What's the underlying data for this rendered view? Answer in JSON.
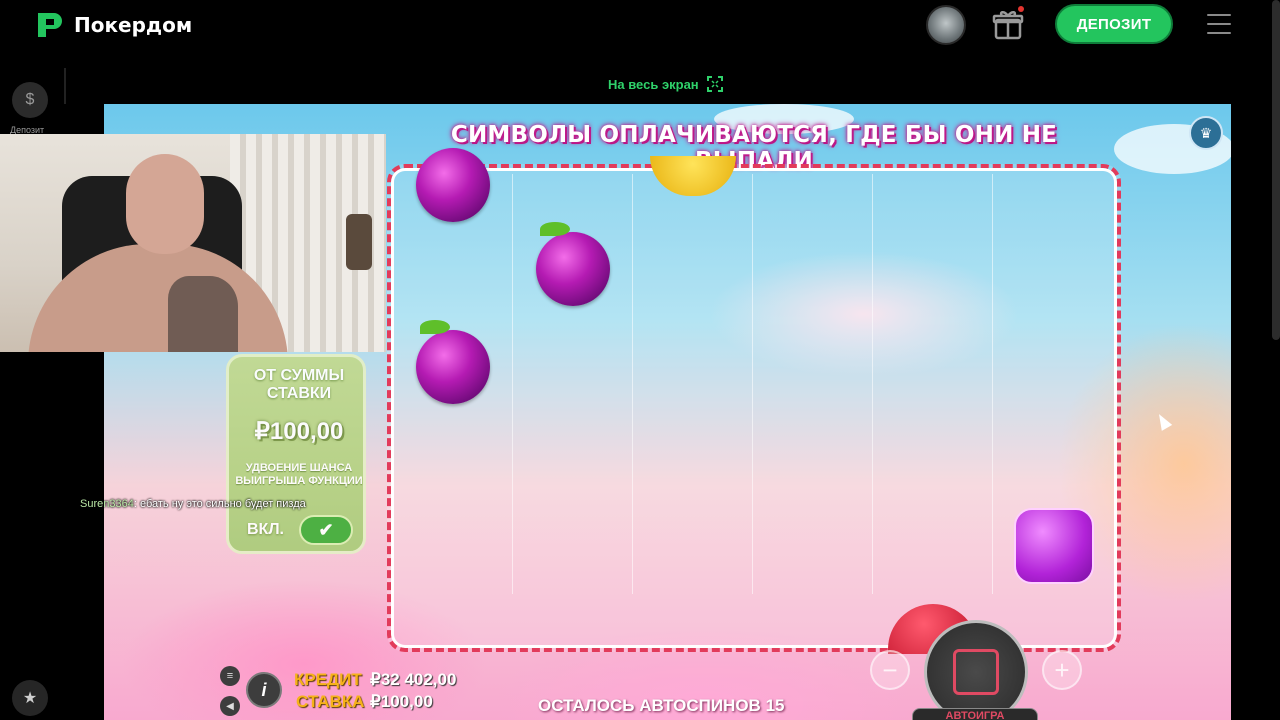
{
  "header": {
    "logo_text": "Покердом",
    "deposit_label": "ДЕПОЗИТ"
  },
  "rail": {
    "deposit_label": "Депозит"
  },
  "fullscreen_label": "На весь экран",
  "game": {
    "banner": "СИМВОЛЫ ОПЛАЧИВАЮТСЯ, ГДЕ БЫ ОНИ НЕ ВЫПАЛИ",
    "ante": {
      "title": "ОТ СУММЫ СТАВКИ",
      "amount": "₽100,00",
      "description": "УДВОЕНИЕ ШАНСА ВЫИГРЫША ФУНКЦИИ",
      "toggle_label": "ВКЛ.",
      "toggle_on": true
    },
    "credit_label": "КРЕДИТ",
    "credit_value": "₽32 402,00",
    "bet_label": "СТАВКА",
    "bet_value": "₽100,00",
    "autospins_text": "ОСТАЛОСЬ АВТОСПИНОВ",
    "autospins_count": "15",
    "autoplay_label": "АВТОИГРА",
    "symbols": [
      "plum",
      "plum",
      "plum",
      "banana",
      "candy-square",
      "heart"
    ]
  },
  "chat": {
    "user": "Suren3364",
    "message": "ебать ну это сильно будет пизда"
  },
  "colors": {
    "brand_green": "#23c55e",
    "accent_pink": "#e23b5b",
    "credit_gold": "#f6b219"
  }
}
